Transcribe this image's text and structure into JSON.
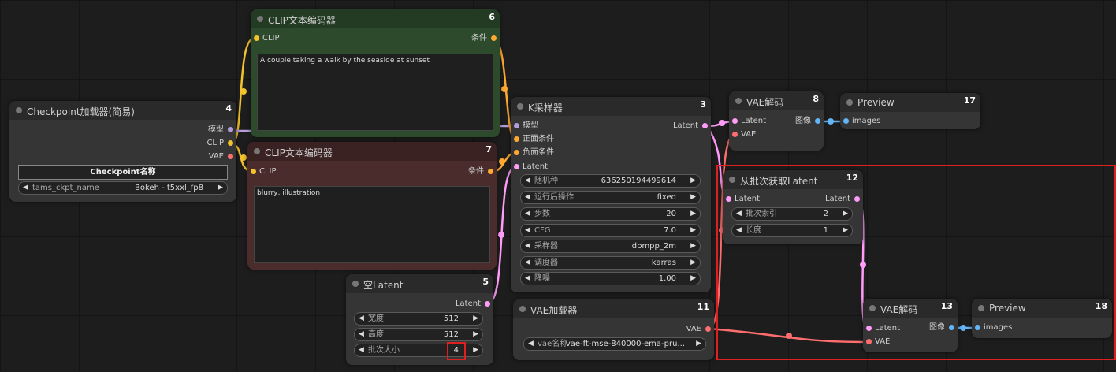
{
  "colors": {
    "clip_pin": "#f3c22c",
    "model_pin": "#b39ddb",
    "vae_pin": "#ff6e6e",
    "cond_pin": "#ffa931",
    "latent_pin": "#ff9cf9",
    "image_pin": "#64b5f6",
    "highlight": "#e02020",
    "positive_node_bg": "#2a4a2a",
    "negative_node_bg": "#4a2a2a"
  },
  "nodes": {
    "checkpoint": {
      "title": "Checkpoint加载器(简易)",
      "id": "4",
      "outputs": {
        "model": "模型",
        "clip": "CLIP",
        "vae": "VAE"
      },
      "name_header": "Checkpoint名称",
      "widget_label": "tams_ckpt_name",
      "widget_value": "Bokeh - t5xxl_fp8"
    },
    "clip_pos": {
      "title": "CLIP文本编码器",
      "id": "6",
      "input_clip": "CLIP",
      "output": "条件",
      "text": "A couple taking a walk by the seaside at sunset"
    },
    "clip_neg": {
      "title": "CLIP文本编码器",
      "id": "7",
      "input_clip": "CLIP",
      "output": "条件",
      "text": "blurry, illustration"
    },
    "empty_latent": {
      "title": "空Latent",
      "id": "5",
      "output": "Latent",
      "widgets": [
        {
          "label": "宽度",
          "value": "512"
        },
        {
          "label": "高度",
          "value": "512"
        },
        {
          "label": "批次大小",
          "value": "4"
        }
      ]
    },
    "ksampler": {
      "title": "K采样器",
      "id": "3",
      "inputs": [
        "模型",
        "正面条件",
        "负面条件",
        "Latent"
      ],
      "output": "Latent",
      "widgets": [
        {
          "label": "随机种",
          "value": "636250194499614"
        },
        {
          "label": "运行后操作",
          "value": "fixed"
        },
        {
          "label": "步数",
          "value": "20"
        },
        {
          "label": "CFG",
          "value": "7.0"
        },
        {
          "label": "采样器",
          "value": "dpmpp_2m"
        },
        {
          "label": "调度器",
          "value": "karras"
        },
        {
          "label": "降噪",
          "value": "1.00"
        }
      ]
    },
    "vae_loader": {
      "title": "VAE加载器",
      "id": "11",
      "output": "VAE",
      "widget_label": "vae名称",
      "widget_value": "vae-ft-mse-840000-ema-pru..."
    },
    "vae_decode_8": {
      "title": "VAE解码",
      "id": "8",
      "inputs": [
        "Latent",
        "VAE"
      ],
      "output": "图像"
    },
    "preview_17": {
      "title": "Preview",
      "id": "17",
      "input": "images"
    },
    "latent_from_batch": {
      "title": "从批次获取Latent",
      "id": "12",
      "input": "Latent",
      "output": "Latent",
      "widgets": [
        {
          "label": "批次索引",
          "value": "2"
        },
        {
          "label": "长度",
          "value": "1"
        }
      ]
    },
    "vae_decode_13": {
      "title": "VAE解码",
      "id": "13",
      "inputs": [
        "Latent",
        "VAE"
      ],
      "output": "图像"
    },
    "preview_18": {
      "title": "Preview",
      "id": "18",
      "input": "images"
    }
  }
}
